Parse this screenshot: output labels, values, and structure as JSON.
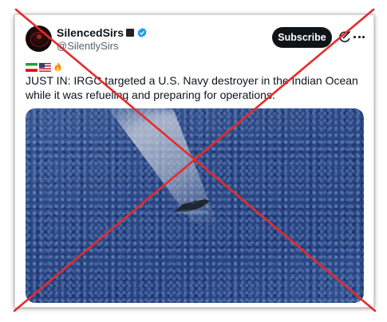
{
  "tweet": {
    "display_name": "SilencedSirs",
    "handle": "@SilentlySirs",
    "subscribe_label": "Subscribe",
    "emojis": [
      "iran-flag",
      "us-flag",
      "fire"
    ],
    "text": "JUST IN: IRGC targeted a U.S. Navy destroyer in the Indian Ocean while it was refueling and preparing for operations.",
    "verified_color": "#1d9bf0"
  },
  "overlay": {
    "cross_color": "#e52b2b"
  },
  "icons": {
    "verified": "verified-badge-icon",
    "grok": "grok-icon",
    "more": "more-options-icon"
  }
}
